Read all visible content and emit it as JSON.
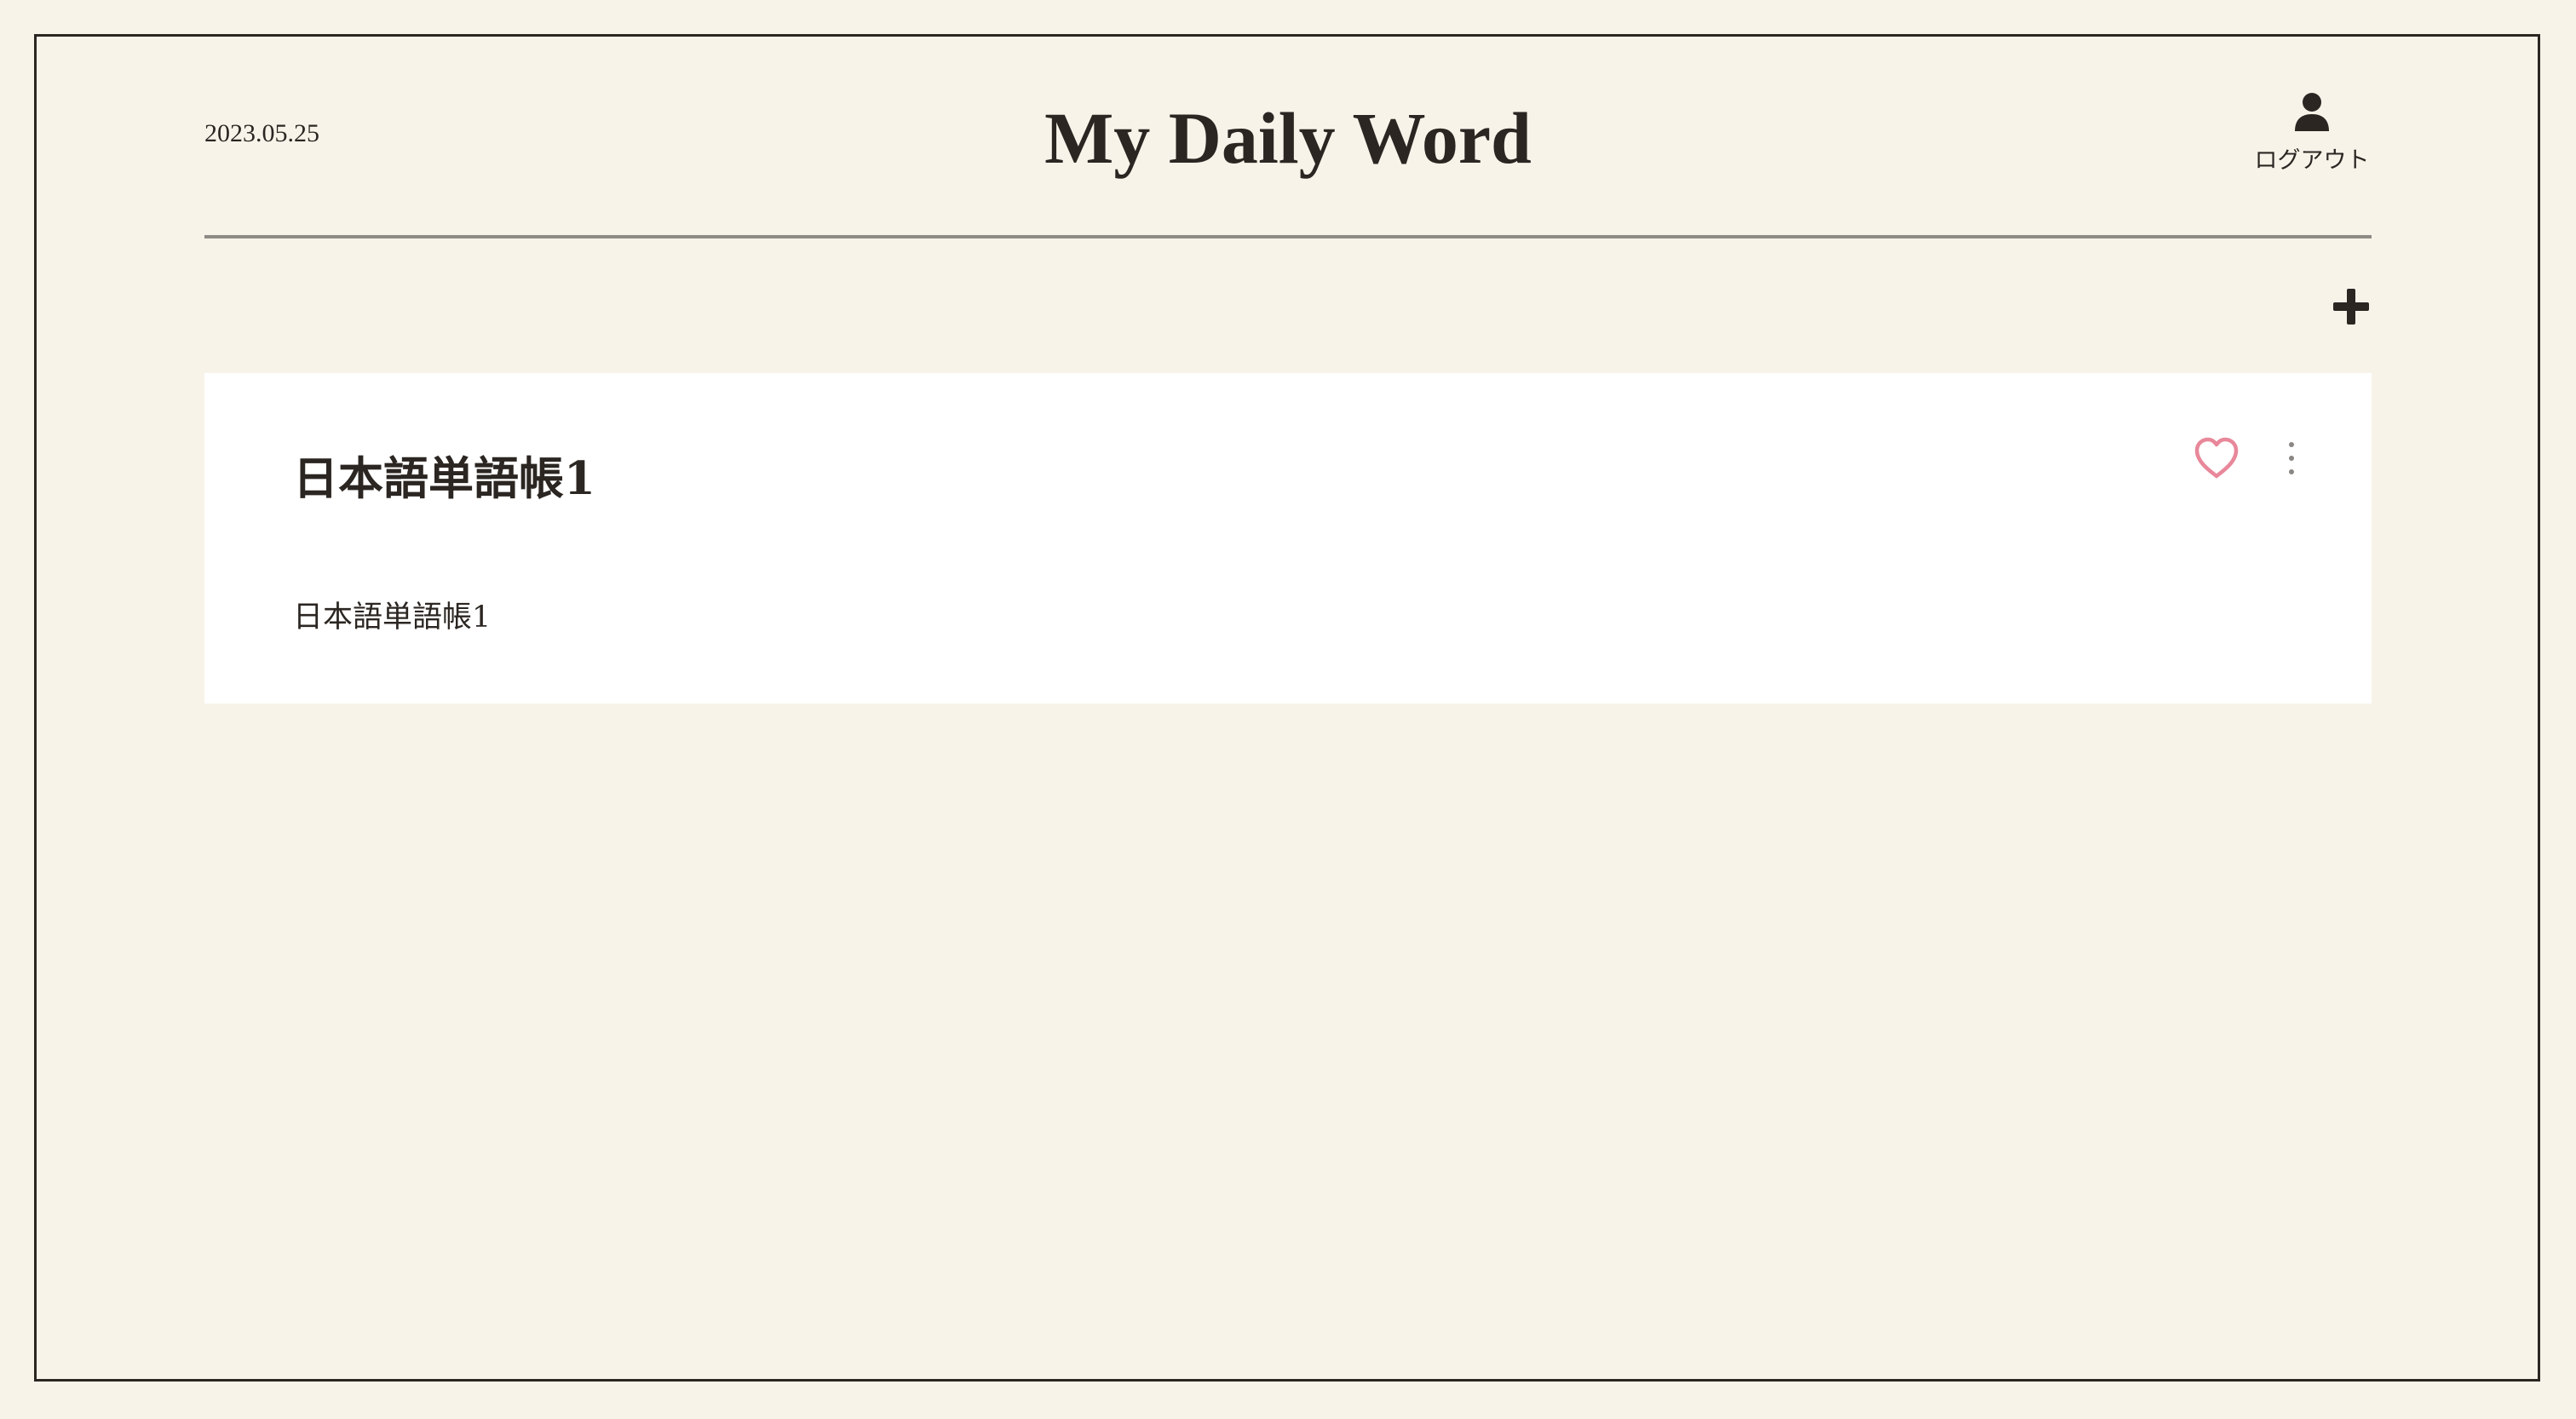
{
  "header": {
    "date": "2023.05.25",
    "title": "My Daily Word",
    "logout_label": "ログアウト",
    "user_icon": "user-icon"
  },
  "toolbar": {
    "add_icon": "plus-icon"
  },
  "cards": [
    {
      "title": "日本語単語帳1",
      "description": "日本語単語帳1",
      "favorite_icon": "heart-icon",
      "menu_icon": "more-vertical-icon"
    }
  ],
  "colors": {
    "background": "#f8f3e9",
    "card": "#ffffff",
    "text": "#2b2622",
    "heart": "#e8889a",
    "menu_dots": "#8a8683"
  }
}
